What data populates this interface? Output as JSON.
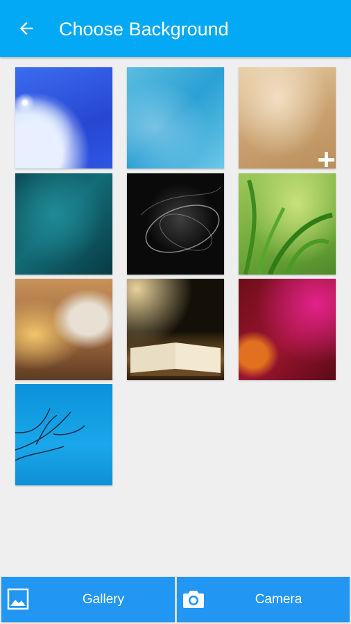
{
  "header": {
    "title": "Choose Background",
    "back_icon": "arrow-left-icon",
    "color": "#03a9f4"
  },
  "backgrounds": [
    {
      "name": "blue-sky-clouds"
    },
    {
      "name": "light-blue-sky"
    },
    {
      "name": "tan-parchment"
    },
    {
      "name": "teal-cavern"
    },
    {
      "name": "black-light-swirl"
    },
    {
      "name": "green-grass"
    },
    {
      "name": "shepherd-landscape"
    },
    {
      "name": "open-bible-light"
    },
    {
      "name": "crimson-flower"
    },
    {
      "name": "blue-tree"
    }
  ],
  "actions": {
    "gallery_label": "Gallery",
    "camera_label": "Camera",
    "gallery_icon": "image-icon",
    "camera_icon": "camera-icon",
    "color": "#2196f3"
  }
}
